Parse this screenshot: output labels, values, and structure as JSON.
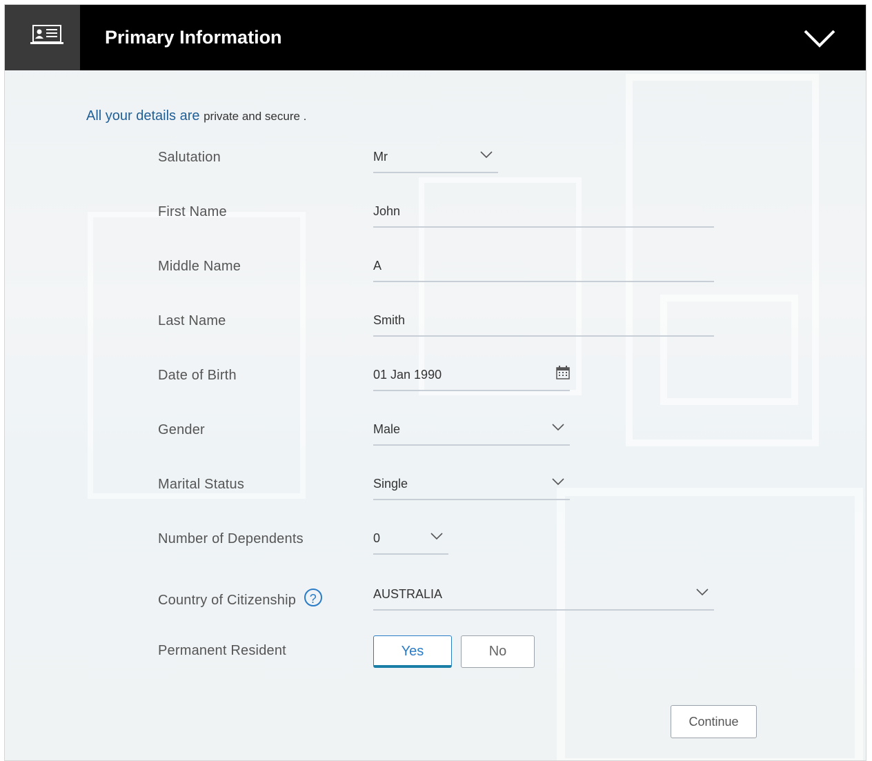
{
  "header": {
    "title": "Primary Information",
    "icon": "id-card-icon",
    "toggle_icon": "chevron-down-icon"
  },
  "privacy": {
    "highlight": "All your details are",
    "rest": "private and secure ."
  },
  "form": {
    "salutation": {
      "label": "Salutation",
      "value": "Mr"
    },
    "first_name": {
      "label": "First Name",
      "value": "John"
    },
    "middle_name": {
      "label": "Middle Name",
      "value": "A"
    },
    "last_name": {
      "label": "Last Name",
      "value": "Smith"
    },
    "date_of_birth": {
      "label": "Date of Birth",
      "value": "01 Jan 1990",
      "icon": "calendar-icon"
    },
    "gender": {
      "label": "Gender",
      "value": "Male"
    },
    "marital_status": {
      "label": "Marital Status",
      "value": "Single"
    },
    "dependents": {
      "label": "Number of Dependents",
      "value": "0"
    },
    "citizenship": {
      "label": "Country of Citizenship",
      "value": "AUSTRALIA",
      "help": "?"
    },
    "permanent_resident": {
      "label": "Permanent Resident",
      "yes": "Yes",
      "no": "No",
      "selected": "Yes"
    }
  },
  "actions": {
    "continue": "Continue"
  },
  "colors": {
    "header_bg": "#000000",
    "accent": "#2a7cc7",
    "link": "#1f5f96"
  }
}
